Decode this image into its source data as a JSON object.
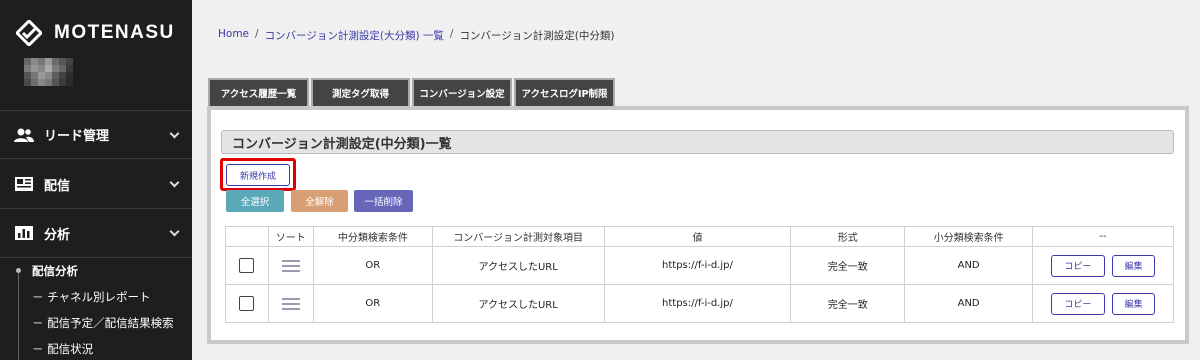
{
  "sidebar": {
    "logo_text": "MOTENASU",
    "nav": [
      {
        "label": "リード管理",
        "icon": "users-icon"
      },
      {
        "label": "配信",
        "icon": "newsletter-icon"
      },
      {
        "label": "分析",
        "icon": "bar-chart-icon"
      }
    ],
    "sub_items": [
      {
        "label": "配信分析"
      },
      {
        "label": "－ チャネル別レポート"
      },
      {
        "label": "－ 配信予定／配信結果検索"
      },
      {
        "label": "－ 配信状況"
      }
    ]
  },
  "breadcrumb": {
    "home": "Home",
    "sep": "/",
    "parent": "コンバージョン計測設定(大分類) 一覧",
    "current": "コンバージョン計測設定(中分類)"
  },
  "tabs": [
    {
      "label": "アクセス履歴一覧"
    },
    {
      "label": "測定タグ取得"
    },
    {
      "label": "コンバージョン設定"
    },
    {
      "label": "アクセスログIP制限"
    }
  ],
  "panel": {
    "title": "コンバージョン計測設定(中分類)一覧",
    "new_button": "新規作成",
    "select_all": "全選択",
    "deselect_all": "全解除",
    "bulk_delete": "一括削除"
  },
  "table": {
    "headers": [
      "",
      "ソート",
      "中分類検索条件",
      "コンバージョン計測対象項目",
      "値",
      "形式",
      "小分類検索条件",
      "--"
    ],
    "rows": [
      {
        "condition": "OR",
        "target": "アクセスしたURL",
        "value": "https://f-i-d.jp/",
        "format": "完全一致",
        "sub_condition": "AND",
        "copy": "コピー",
        "edit": "編集"
      },
      {
        "condition": "OR",
        "target": "アクセスしたURL",
        "value": "https://f-i-d.jp/",
        "format": "完全一致",
        "sub_condition": "AND",
        "copy": "コピー",
        "edit": "編集"
      }
    ]
  },
  "colors": {
    "sidebar_bg": "#1e1e1e",
    "accent_blue": "#3a3aa8",
    "btn_select_all": "#5aa8b8",
    "btn_deselect_all": "#d89e74",
    "btn_bulk_delete": "#6666bb",
    "highlight": "#e00000"
  }
}
